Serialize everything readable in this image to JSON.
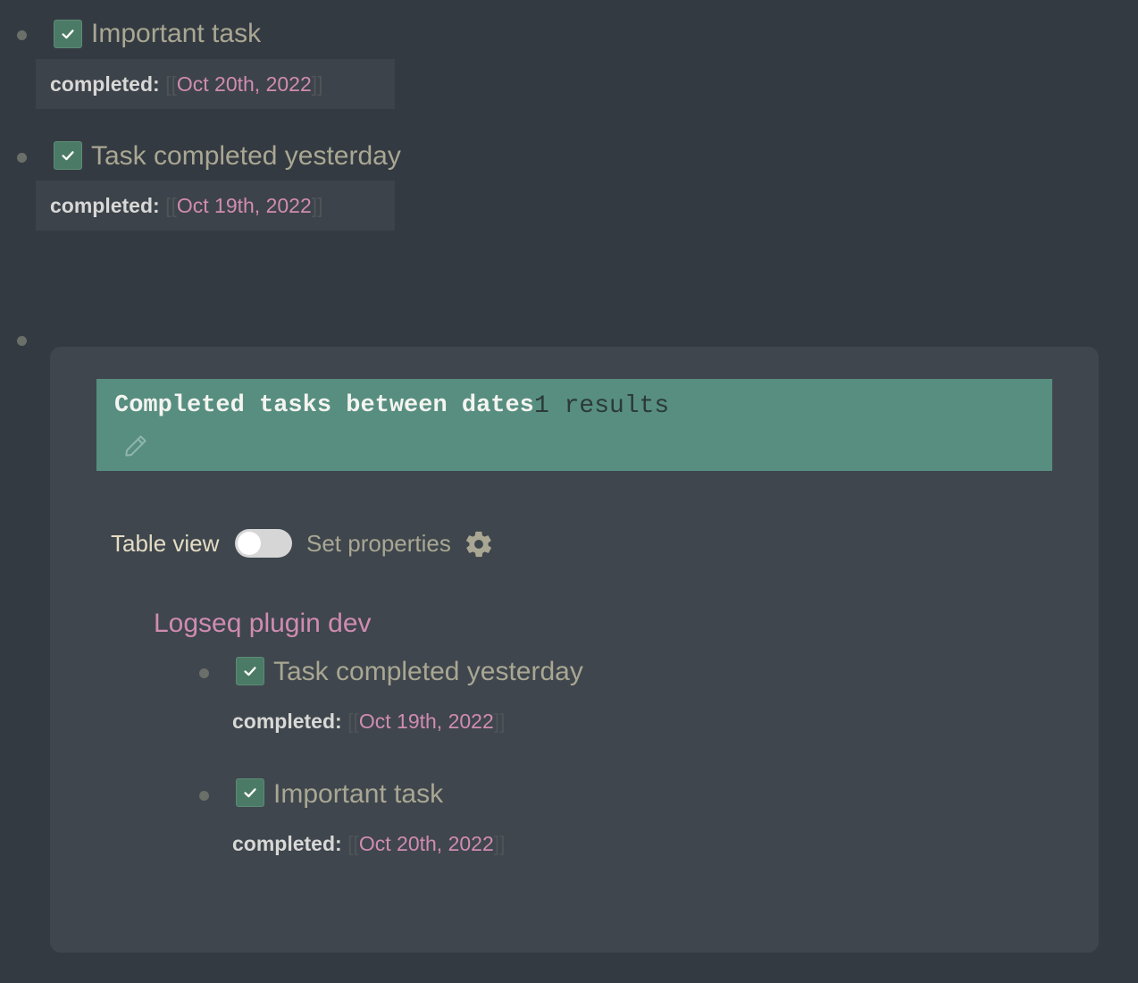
{
  "blocks": [
    {
      "title": "Important task",
      "property_key": "completed:",
      "property_value": "Oct 20th, 2022"
    },
    {
      "title": "Task completed yesterday",
      "property_key": "completed:",
      "property_value": "Oct 19th, 2022"
    }
  ],
  "query": {
    "title": "Completed tasks between dates",
    "count": "1 results",
    "edit_icon": "pencil-icon",
    "toolbar": {
      "table_view_label": "Table view",
      "table_view_enabled": false,
      "set_properties_label": "Set properties",
      "settings_icon": "gear-icon"
    },
    "results": [
      {
        "page": "Logseq plugin dev",
        "tasks": [
          {
            "title": "Task completed yesterday",
            "property_key": "completed:",
            "property_value": "Oct 19th, 2022"
          },
          {
            "title": "Important task",
            "property_key": "completed:",
            "property_value": "Oct 20th, 2022"
          }
        ]
      }
    ]
  },
  "brackets": {
    "open": "[[",
    "close": "]]"
  },
  "colors": {
    "background": "#343a41",
    "card": "#3f464d",
    "query_header": "#578e80",
    "checkbox": "#4b7a66",
    "link": "#d08cb0",
    "task_text": "#a9a793"
  }
}
